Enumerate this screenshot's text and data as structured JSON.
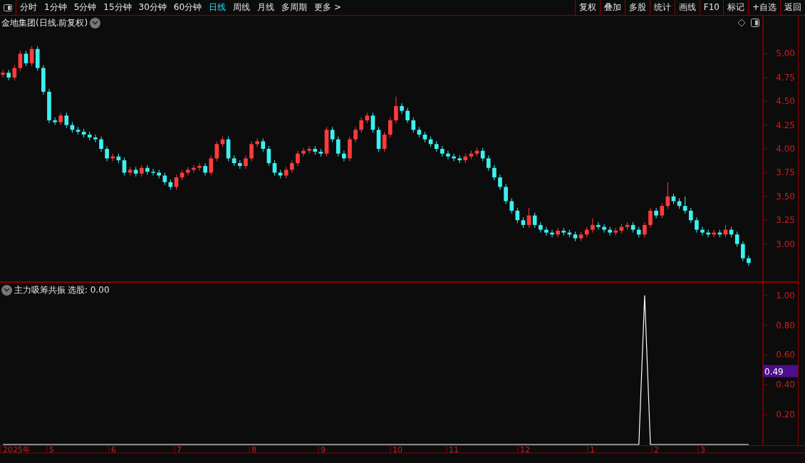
{
  "toolbar": {
    "periods": [
      {
        "label": "分时",
        "selected": false
      },
      {
        "label": "1分钟",
        "selected": false
      },
      {
        "label": "5分钟",
        "selected": false
      },
      {
        "label": "15分钟",
        "selected": false
      },
      {
        "label": "30分钟",
        "selected": false
      },
      {
        "label": "60分钟",
        "selected": false
      },
      {
        "label": "日线",
        "selected": true
      },
      {
        "label": "周线",
        "selected": false
      },
      {
        "label": "月线",
        "selected": false
      },
      {
        "label": "多周期",
        "selected": false
      },
      {
        "label": "更多 >",
        "selected": false
      }
    ],
    "buttons": [
      "复权",
      "叠加",
      "多股",
      "统计",
      "画线",
      "F10",
      "标记",
      "+自选",
      "返回"
    ]
  },
  "price_panel": {
    "title": "金地集团(日线.前复权)",
    "chart_data": {
      "type": "candlestick",
      "ylim": [
        2.6,
        5.4
      ],
      "yticks": [
        {
          "value": 3.0,
          "label": "3.00"
        },
        {
          "value": 3.25,
          "label": "3.25"
        },
        {
          "value": 3.5,
          "label": "3.50"
        },
        {
          "value": 3.75,
          "label": "3.75"
        },
        {
          "value": 4.0,
          "label": "4.00"
        },
        {
          "value": 4.25,
          "label": "4.25"
        },
        {
          "value": 4.5,
          "label": "4.50"
        },
        {
          "value": 4.75,
          "label": "4.75"
        },
        {
          "value": 5.0,
          "label": "5.00"
        }
      ],
      "categories": [
        null,
        null,
        null,
        null,
        null,
        null,
        null,
        null,
        null,
        null,
        null,
        null,
        null,
        null,
        null,
        null,
        null,
        null,
        null,
        null,
        null,
        null,
        null,
        null,
        null,
        null,
        null,
        null,
        null,
        null,
        null,
        null,
        null,
        null,
        null,
        null,
        null,
        null,
        null,
        null,
        null,
        null,
        null,
        null,
        null,
        null,
        null,
        null,
        null,
        null,
        null,
        null,
        null,
        null,
        null,
        null,
        null,
        null,
        null,
        null,
        null,
        null,
        null,
        null,
        null,
        null,
        null,
        null,
        null,
        null,
        null,
        null,
        null,
        null,
        null,
        null,
        null,
        null,
        null,
        null,
        null,
        null,
        null,
        null,
        null,
        null,
        null,
        null,
        null,
        null,
        null,
        null,
        null,
        null,
        null,
        null,
        null,
        null,
        null,
        null,
        null,
        null,
        null,
        null,
        null,
        null,
        null,
        null,
        null,
        null,
        null,
        null,
        null,
        null,
        null,
        null,
        null,
        null,
        null,
        null,
        null,
        null,
        null,
        null,
        null,
        null,
        null,
        null,
        null,
        null
      ],
      "ohlc": [
        [
          4.78,
          4.83,
          4.75,
          4.8
        ],
        [
          4.8,
          4.83,
          4.72,
          4.75
        ],
        [
          4.75,
          4.88,
          4.72,
          4.85
        ],
        [
          4.85,
          5.03,
          4.82,
          5.0
        ],
        [
          5.0,
          5.03,
          4.87,
          4.9
        ],
        [
          4.9,
          5.08,
          4.87,
          5.05
        ],
        [
          5.05,
          5.08,
          4.82,
          4.85
        ],
        [
          4.85,
          4.88,
          4.57,
          4.6
        ],
        [
          4.6,
          4.63,
          4.27,
          4.3
        ],
        [
          4.3,
          4.33,
          4.25,
          4.28
        ],
        [
          4.28,
          4.38,
          4.25,
          4.35
        ],
        [
          4.35,
          4.38,
          4.22,
          4.25
        ],
        [
          4.25,
          4.28,
          4.17,
          4.2
        ],
        [
          4.2,
          4.23,
          4.15,
          4.18
        ],
        [
          4.18,
          4.21,
          4.12,
          4.15
        ],
        [
          4.15,
          4.18,
          4.09,
          4.12
        ],
        [
          4.12,
          4.15,
          4.07,
          4.1
        ],
        [
          4.1,
          4.13,
          3.97,
          4.0
        ],
        [
          4.0,
          4.03,
          3.87,
          3.9
        ],
        [
          3.9,
          3.95,
          3.87,
          3.92
        ],
        [
          3.92,
          3.95,
          3.85,
          3.88
        ],
        [
          3.88,
          3.91,
          3.72,
          3.75
        ],
        [
          3.75,
          3.81,
          3.72,
          3.78
        ],
        [
          3.78,
          3.81,
          3.71,
          3.74
        ],
        [
          3.74,
          3.83,
          3.71,
          3.8
        ],
        [
          3.8,
          3.83,
          3.73,
          3.76
        ],
        [
          3.76,
          3.79,
          3.72,
          3.75
        ],
        [
          3.75,
          3.78,
          3.69,
          3.72
        ],
        [
          3.72,
          3.75,
          3.62,
          3.65
        ],
        [
          3.65,
          3.68,
          3.57,
          3.6
        ],
        [
          3.6,
          3.73,
          3.57,
          3.7
        ],
        [
          3.7,
          3.78,
          3.67,
          3.75
        ],
        [
          3.75,
          3.81,
          3.72,
          3.78
        ],
        [
          3.78,
          3.83,
          3.75,
          3.8
        ],
        [
          3.8,
          3.85,
          3.77,
          3.82
        ],
        [
          3.82,
          3.85,
          3.72,
          3.75
        ],
        [
          3.75,
          3.93,
          3.72,
          3.9
        ],
        [
          3.9,
          4.08,
          3.87,
          4.05
        ],
        [
          4.05,
          4.13,
          4.02,
          4.1
        ],
        [
          4.1,
          4.13,
          3.87,
          3.9
        ],
        [
          3.9,
          3.93,
          3.82,
          3.85
        ],
        [
          3.85,
          3.88,
          3.79,
          3.82
        ],
        [
          3.82,
          3.93,
          3.79,
          3.9
        ],
        [
          3.9,
          4.08,
          3.87,
          4.05
        ],
        [
          4.05,
          4.11,
          4.02,
          4.08
        ],
        [
          4.08,
          4.11,
          3.97,
          4.0
        ],
        [
          4.0,
          4.03,
          3.82,
          3.85
        ],
        [
          3.85,
          3.88,
          3.72,
          3.75
        ],
        [
          3.75,
          3.78,
          3.69,
          3.72
        ],
        [
          3.72,
          3.81,
          3.69,
          3.78
        ],
        [
          3.78,
          3.88,
          3.75,
          3.85
        ],
        [
          3.85,
          3.98,
          3.82,
          3.95
        ],
        [
          3.95,
          4.01,
          3.92,
          3.98
        ],
        [
          3.98,
          4.03,
          3.95,
          4.0
        ],
        [
          4.0,
          4.03,
          3.94,
          3.97
        ],
        [
          3.97,
          4.0,
          3.92,
          3.95
        ],
        [
          3.95,
          4.23,
          3.92,
          4.2
        ],
        [
          4.2,
          4.23,
          4.07,
          4.1
        ],
        [
          4.1,
          4.13,
          3.92,
          3.95
        ],
        [
          3.95,
          3.98,
          3.87,
          3.9
        ],
        [
          3.9,
          4.13,
          3.87,
          4.1
        ],
        [
          4.1,
          4.23,
          4.07,
          4.2
        ],
        [
          4.2,
          4.33,
          4.17,
          4.3
        ],
        [
          4.3,
          4.38,
          4.27,
          4.35
        ],
        [
          4.35,
          4.38,
          4.17,
          4.2
        ],
        [
          4.2,
          4.23,
          3.97,
          4.0
        ],
        [
          4.0,
          4.18,
          3.97,
          4.15
        ],
        [
          4.15,
          4.33,
          4.12,
          4.3
        ],
        [
          4.3,
          4.55,
          4.27,
          4.45
        ],
        [
          4.45,
          4.48,
          4.37,
          4.4
        ],
        [
          4.4,
          4.43,
          4.27,
          4.3
        ],
        [
          4.3,
          4.33,
          4.17,
          4.2
        ],
        [
          4.2,
          4.23,
          4.12,
          4.15
        ],
        [
          4.15,
          4.18,
          4.07,
          4.1
        ],
        [
          4.1,
          4.13,
          4.02,
          4.05
        ],
        [
          4.05,
          4.08,
          3.97,
          4.0
        ],
        [
          4.0,
          4.03,
          3.92,
          3.95
        ],
        [
          3.95,
          3.98,
          3.89,
          3.92
        ],
        [
          3.92,
          3.95,
          3.87,
          3.9
        ],
        [
          3.9,
          3.93,
          3.85,
          3.88
        ],
        [
          3.88,
          3.95,
          3.85,
          3.92
        ],
        [
          3.92,
          3.98,
          3.89,
          3.95
        ],
        [
          3.95,
          4.01,
          3.92,
          3.98
        ],
        [
          3.98,
          4.01,
          3.87,
          3.9
        ],
        [
          3.9,
          3.93,
          3.77,
          3.8
        ],
        [
          3.8,
          3.83,
          3.67,
          3.7
        ],
        [
          3.7,
          3.73,
          3.57,
          3.6
        ],
        [
          3.6,
          3.63,
          3.42,
          3.45
        ],
        [
          3.45,
          3.48,
          3.32,
          3.35
        ],
        [
          3.35,
          3.38,
          3.22,
          3.25
        ],
        [
          3.25,
          3.28,
          3.17,
          3.2
        ],
        [
          3.2,
          3.38,
          3.17,
          3.3
        ],
        [
          3.3,
          3.33,
          3.17,
          3.2
        ],
        [
          3.2,
          3.23,
          3.12,
          3.15
        ],
        [
          3.15,
          3.18,
          3.09,
          3.12
        ],
        [
          3.12,
          3.15,
          3.07,
          3.1
        ],
        [
          3.1,
          3.17,
          3.07,
          3.14
        ],
        [
          3.14,
          3.17,
          3.09,
          3.12
        ],
        [
          3.12,
          3.15,
          3.07,
          3.1
        ],
        [
          3.1,
          3.13,
          3.03,
          3.06
        ],
        [
          3.06,
          3.13,
          3.03,
          3.1
        ],
        [
          3.1,
          3.18,
          3.07,
          3.15
        ],
        [
          3.15,
          3.27,
          3.12,
          3.2
        ],
        [
          3.2,
          3.23,
          3.15,
          3.18
        ],
        [
          3.18,
          3.21,
          3.12,
          3.15
        ],
        [
          3.15,
          3.18,
          3.09,
          3.12
        ],
        [
          3.12,
          3.17,
          3.09,
          3.14
        ],
        [
          3.14,
          3.21,
          3.11,
          3.18
        ],
        [
          3.18,
          3.23,
          3.15,
          3.2
        ],
        [
          3.2,
          3.23,
          3.12,
          3.15
        ],
        [
          3.15,
          3.18,
          3.07,
          3.1
        ],
        [
          3.1,
          3.23,
          3.07,
          3.2
        ],
        [
          3.2,
          3.38,
          3.17,
          3.35
        ],
        [
          3.35,
          3.38,
          3.27,
          3.3
        ],
        [
          3.3,
          3.43,
          3.27,
          3.4
        ],
        [
          3.4,
          3.65,
          3.37,
          3.5
        ],
        [
          3.5,
          3.53,
          3.42,
          3.45
        ],
        [
          3.45,
          3.48,
          3.37,
          3.4
        ],
        [
          3.4,
          3.5,
          3.32,
          3.35
        ],
        [
          3.35,
          3.38,
          3.22,
          3.25
        ],
        [
          3.25,
          3.28,
          3.12,
          3.15
        ],
        [
          3.15,
          3.18,
          3.09,
          3.12
        ],
        [
          3.12,
          3.15,
          3.07,
          3.1
        ],
        [
          3.1,
          3.15,
          3.07,
          3.12
        ],
        [
          3.12,
          3.15,
          3.07,
          3.1
        ],
        [
          3.1,
          3.2,
          3.07,
          3.15
        ],
        [
          3.15,
          3.18,
          3.07,
          3.1
        ],
        [
          3.1,
          3.13,
          2.97,
          3.0
        ],
        [
          3.0,
          3.03,
          2.82,
          2.85
        ],
        [
          2.85,
          2.88,
          2.77,
          2.8
        ]
      ]
    }
  },
  "indicator_panel": {
    "title": "主力吸筹共振",
    "reading": "选股: 0.00",
    "cursor_value": "0.49",
    "chart_data": {
      "type": "line",
      "ylim": [
        0,
        1.09
      ],
      "yticks": [
        {
          "value": 0.2,
          "label": "0.20"
        },
        {
          "value": 0.4,
          "label": "0.40"
        },
        {
          "value": 0.6,
          "label": "0.60"
        },
        {
          "value": 0.8,
          "label": "0.80"
        },
        {
          "value": 1.0,
          "label": "1.00"
        }
      ],
      "series": [
        {
          "color": "#ffffff",
          "values": [
            0,
            0,
            0,
            0,
            0,
            0,
            0,
            0,
            0,
            0,
            0,
            0,
            0,
            0,
            0,
            0,
            0,
            0,
            0,
            0,
            0,
            0,
            0,
            0,
            0,
            0,
            0,
            0,
            0,
            0,
            0,
            0,
            0,
            0,
            0,
            0,
            0,
            0,
            0,
            0,
            0,
            0,
            0,
            0,
            0,
            0,
            0,
            0,
            0,
            0,
            0,
            0,
            0,
            0,
            0,
            0,
            0,
            0,
            0,
            0,
            0,
            0,
            0,
            0,
            0,
            0,
            0,
            0,
            0,
            0,
            0,
            0,
            0,
            0,
            0,
            0,
            0,
            0,
            0,
            0,
            0,
            0,
            0,
            0,
            0,
            0,
            0,
            0,
            0,
            0,
            0,
            0,
            0,
            0,
            0,
            0,
            0,
            0,
            0,
            0,
            0,
            0,
            0,
            0,
            0,
            0,
            0,
            0,
            0,
            0,
            0,
            1,
            0,
            0,
            0,
            0,
            0,
            0,
            0,
            0,
            0,
            0,
            0,
            0,
            0,
            0,
            0,
            0,
            0,
            0
          ]
        }
      ]
    }
  },
  "x_axis": {
    "labels": [
      "2025年",
      "5",
      "6",
      "7",
      "8",
      "9",
      "10",
      "11",
      "12",
      "1",
      "2",
      "3"
    ]
  }
}
